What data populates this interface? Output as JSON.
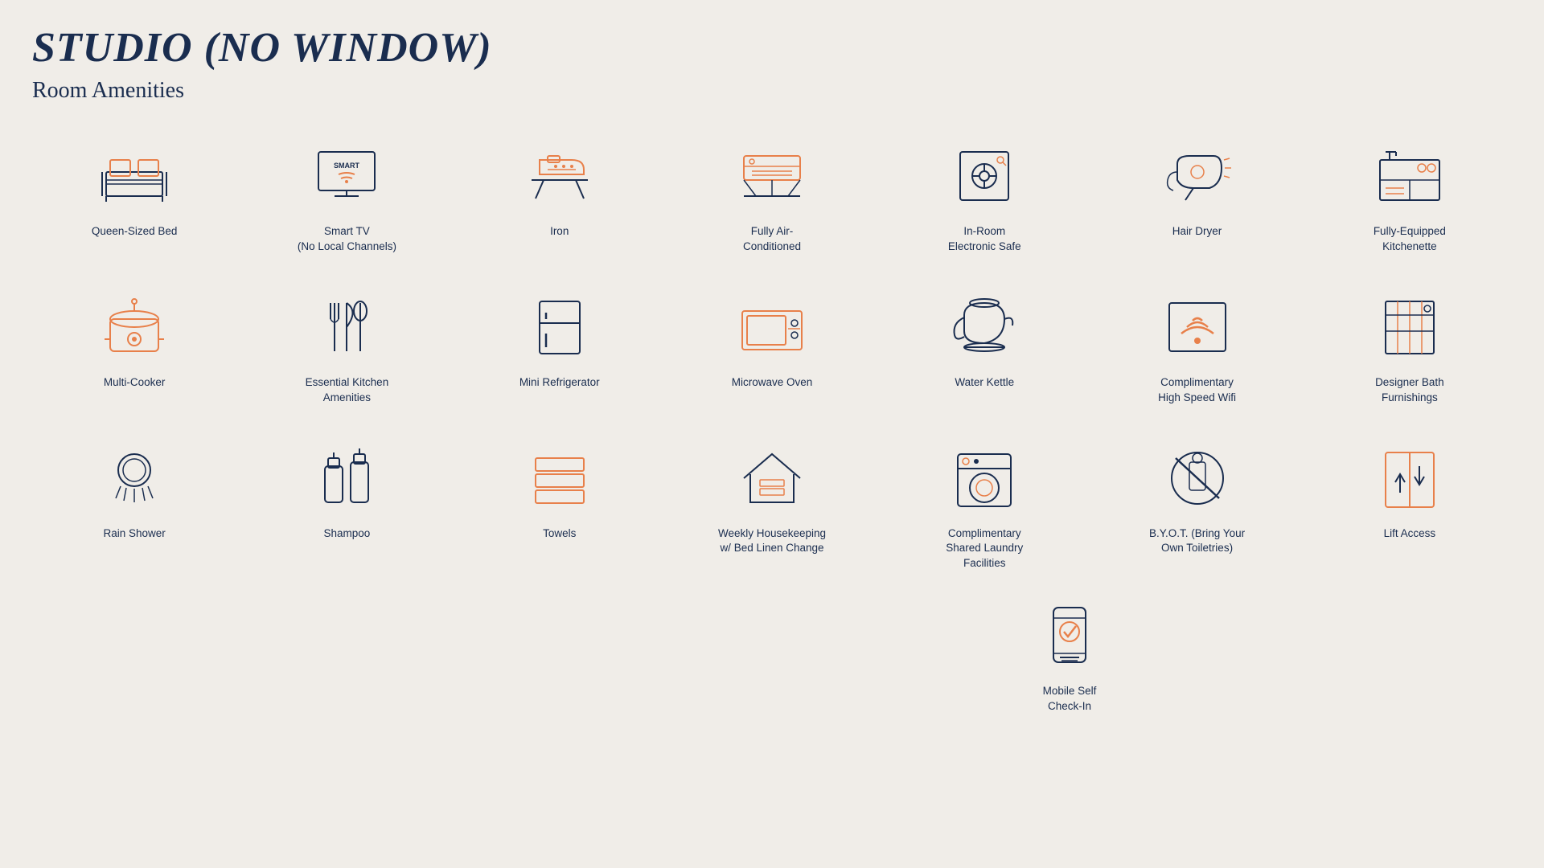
{
  "title": "STUDIO (NO WINDOW)",
  "subtitle": "Room Amenities",
  "amenities": [
    {
      "id": "queen-bed",
      "label": "Queen-Sized Bed",
      "icon": "bed"
    },
    {
      "id": "smart-tv",
      "label": "Smart TV\n(No Local Channels)",
      "icon": "tv"
    },
    {
      "id": "iron",
      "label": "Iron",
      "icon": "iron"
    },
    {
      "id": "air-conditioned",
      "label": "Fully Air-\nConditioned",
      "icon": "ac"
    },
    {
      "id": "safe",
      "label": "In-Room\nElectronic Safe",
      "icon": "safe"
    },
    {
      "id": "hair-dryer",
      "label": "Hair Dryer",
      "icon": "hairdryer"
    },
    {
      "id": "kitchenette",
      "label": "Fully-Equipped\nKitchenette",
      "icon": "kitchenette"
    },
    {
      "id": "multi-cooker",
      "label": "Multi-Cooker",
      "icon": "multicooker"
    },
    {
      "id": "kitchen-amenities",
      "label": "Essential Kitchen\nAmenities",
      "icon": "kitchen"
    },
    {
      "id": "mini-fridge",
      "label": "Mini Refrigerator",
      "icon": "fridge"
    },
    {
      "id": "microwave",
      "label": "Microwave Oven",
      "icon": "microwave"
    },
    {
      "id": "kettle",
      "label": "Water Kettle",
      "icon": "kettle"
    },
    {
      "id": "wifi",
      "label": "Complimentary\nHigh Speed Wifi",
      "icon": "wifi"
    },
    {
      "id": "bath",
      "label": "Designer Bath\nFurnishings",
      "icon": "bath"
    },
    {
      "id": "shower",
      "label": "Rain Shower",
      "icon": "shower"
    },
    {
      "id": "shampoo",
      "label": "Shampoo",
      "icon": "shampoo"
    },
    {
      "id": "towels",
      "label": "Towels",
      "icon": "towels"
    },
    {
      "id": "housekeeping",
      "label": "Weekly Housekeeping\nw/ Bed Linen Change",
      "icon": "housekeeping"
    },
    {
      "id": "laundry",
      "label": "Complimentary\nShared Laundry\nFacilities",
      "icon": "laundry"
    },
    {
      "id": "byot",
      "label": "B.Y.O.T. (Bring Your\nOwn Toiletries)",
      "icon": "byot"
    },
    {
      "id": "lift",
      "label": "Lift Access",
      "icon": "lift"
    },
    {
      "id": "mobile-checkin",
      "label": "Mobile Self\nCheck-In",
      "icon": "mobile"
    }
  ]
}
